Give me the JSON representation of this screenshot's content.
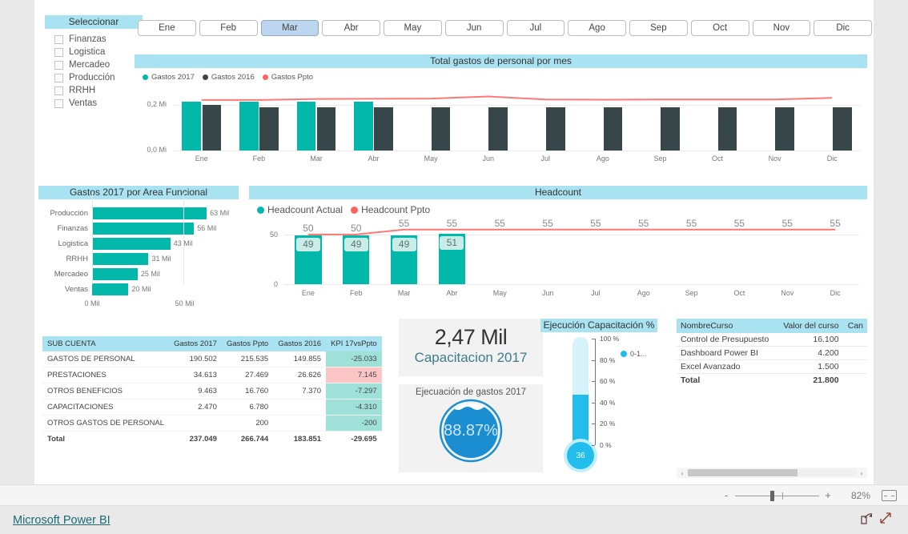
{
  "slicer": {
    "title": "Seleccionar",
    "items": [
      {
        "label": "Finanzas",
        "checked": false
      },
      {
        "label": "Logistica",
        "checked": false
      },
      {
        "label": "Mercadeo",
        "checked": false
      },
      {
        "label": "Producción",
        "checked": false
      },
      {
        "label": "RRHH",
        "checked": false
      },
      {
        "label": "Ventas",
        "checked": false
      }
    ]
  },
  "months": {
    "tiles": [
      "Ene",
      "Feb",
      "Mar",
      "Abr",
      "May",
      "Jun",
      "Jul",
      "Ago",
      "Sep",
      "Oct",
      "Nov",
      "Dic"
    ],
    "selected": "Mar"
  },
  "colors": {
    "teal": "#01b8aa",
    "dark": "#374649",
    "red": "#fd625e",
    "header_blue": "#a9e2f0",
    "kpi_good": "#9fe0d8",
    "kpi_bad": "#fcc5c6",
    "donut_blue": "#1b8ed2",
    "thermo_blue": "#22bdec",
    "link": "#1a6b74"
  },
  "chart_data": [
    {
      "type": "bar",
      "title": "Total gastos de personal por mes",
      "categories": [
        "Ene",
        "Feb",
        "Mar",
        "Abr",
        "May",
        "Jun",
        "Jul",
        "Ago",
        "Sep",
        "Oct",
        "Nov",
        "Dic"
      ],
      "series": [
        {
          "name": "Gastos 2017",
          "color": "#01b8aa",
          "values": [
            0.215,
            0.215,
            0.215,
            0.215,
            null,
            null,
            null,
            null,
            null,
            null,
            null,
            null
          ]
        },
        {
          "name": "Gastos 2016",
          "color": "#374649",
          "values": [
            0.2,
            0.19,
            0.189,
            0.19,
            0.19,
            0.19,
            0.189,
            0.188,
            0.189,
            0.188,
            0.189,
            0.188
          ]
        },
        {
          "name": "Gastos Ppto",
          "color": "#fd625e",
          "type": "line",
          "values": [
            0.222,
            0.222,
            0.226,
            0.227,
            0.228,
            0.237,
            0.224,
            0.223,
            0.224,
            0.224,
            0.224,
            0.231
          ]
        }
      ],
      "ylabel": "",
      "yticks": [
        "0,0 Mi",
        "0,2 Mi"
      ],
      "ylim": [
        0,
        0.26
      ],
      "legend_position": "top-left",
      "grid": true
    },
    {
      "type": "bar",
      "orientation": "horizontal",
      "title": "Gastos 2017 por Area Funcional",
      "categories": [
        "Producción",
        "Finanzas",
        "Logistica",
        "RRHH",
        "Mercadeo",
        "Ventas"
      ],
      "values": [
        63,
        56,
        43,
        31,
        25,
        20
      ],
      "value_labels": [
        "63 Mil",
        "56 Mil",
        "43 Mil",
        "31 Mil",
        "25 Mil",
        "20 Mil"
      ],
      "xticks": [
        "0 Mil",
        "50 Mil"
      ],
      "xlim": [
        0,
        66
      ],
      "color": "#01b8aa"
    },
    {
      "type": "bar",
      "title": "Headcount",
      "categories": [
        "Ene",
        "Feb",
        "Mar",
        "Abr",
        "May",
        "Jun",
        "Jul",
        "Ago",
        "Sep",
        "Oct",
        "Nov",
        "Dic"
      ],
      "series": [
        {
          "name": "Headcount Actual",
          "color": "#01b8aa",
          "values": [
            49,
            49,
            49,
            51,
            null,
            null,
            null,
            null,
            null,
            null,
            null,
            null
          ]
        },
        {
          "name": "Headcount Ppto",
          "color": "#fd625e",
          "type": "line",
          "values": [
            50,
            50,
            55,
            55,
            55,
            55,
            55,
            55,
            55,
            55,
            55,
            55
          ]
        }
      ],
      "ppto_labels": [
        "50",
        "50",
        "55",
        "55",
        "55",
        "55",
        "55",
        "55",
        "55",
        "55",
        "55",
        "55"
      ],
      "actual_labels": [
        "49",
        "49",
        "49",
        "51",
        "",
        "",
        "",
        "",
        "",
        "",
        "",
        ""
      ],
      "yticks": [
        "0",
        "50"
      ],
      "ylim": [
        0,
        58
      ],
      "legend_position": "top-left"
    },
    {
      "type": "table",
      "title": "Sub cuenta matrix",
      "columns": [
        "SUB CUENTA",
        "Gastos 2017",
        "Gastos Ppto",
        "Gastos 2016",
        "KPI 17vsPpto"
      ],
      "rows": [
        {
          "cells": [
            "GASTOS DE PERSONAL",
            "190.502",
            "215.535",
            "149.855",
            "-25.033"
          ],
          "kpi_state": "good"
        },
        {
          "cells": [
            "PRESTACIONES",
            "34.613",
            "27.469",
            "26.626",
            "7.145"
          ],
          "kpi_state": "bad"
        },
        {
          "cells": [
            "OTROS BENEFICIOS",
            "9.463",
            "16.760",
            "7.370",
            "-7.297"
          ],
          "kpi_state": "good"
        },
        {
          "cells": [
            "CAPACITACIONES",
            "2.470",
            "6.780",
            "",
            "-4.310"
          ],
          "kpi_state": "good"
        },
        {
          "cells": [
            "OTROS GASTOS DE PERSONAL",
            "",
            "200",
            "",
            "-200"
          ],
          "kpi_state": "good"
        }
      ],
      "total": {
        "cells": [
          "Total",
          "237.049",
          "266.744",
          "183.851",
          "-29.695"
        ],
        "kpi_state": "none"
      }
    },
    {
      "type": "table",
      "title": "Cursos",
      "columns": [
        "NombreCurso",
        "Valor del curso",
        "Can"
      ],
      "rows": [
        {
          "cells": [
            "Control de Presupuesto",
            "16.100",
            ""
          ]
        },
        {
          "cells": [
            "Dashboard Power BI",
            "4.200",
            ""
          ]
        },
        {
          "cells": [
            "Excel Avanzado",
            "1.500",
            ""
          ]
        }
      ],
      "total": {
        "cells": [
          "Total",
          "21.800",
          ""
        ]
      }
    },
    {
      "type": "gauge",
      "title": "Ejecución Capacitación %",
      "value": 36,
      "value_label": "36",
      "min": 0,
      "max": 100,
      "ticks": [
        "100 %",
        "80 %",
        "60 %",
        "40 %",
        "20 %",
        "0 %"
      ],
      "legend": "0-1...",
      "color": "#22bdec"
    }
  ],
  "card": {
    "value": "2,47 Mil",
    "label": "Capacitacion 2017"
  },
  "donut": {
    "title": "Ejecuación de gastos 2017",
    "value_label": "88.87%",
    "value": 88.87
  },
  "statusbar": {
    "zoom_minus": "-",
    "zoom_plus": "+",
    "zoom_percent": "82%",
    "fit_icon": "fit-to-page-icon"
  },
  "footer": {
    "brand": "Microsoft Power BI",
    "share_icon": "share-icon",
    "fullscreen_icon": "fullscreen-icon"
  },
  "scrollbar": {
    "left_arrow": "‹",
    "right_arrow": "›"
  }
}
